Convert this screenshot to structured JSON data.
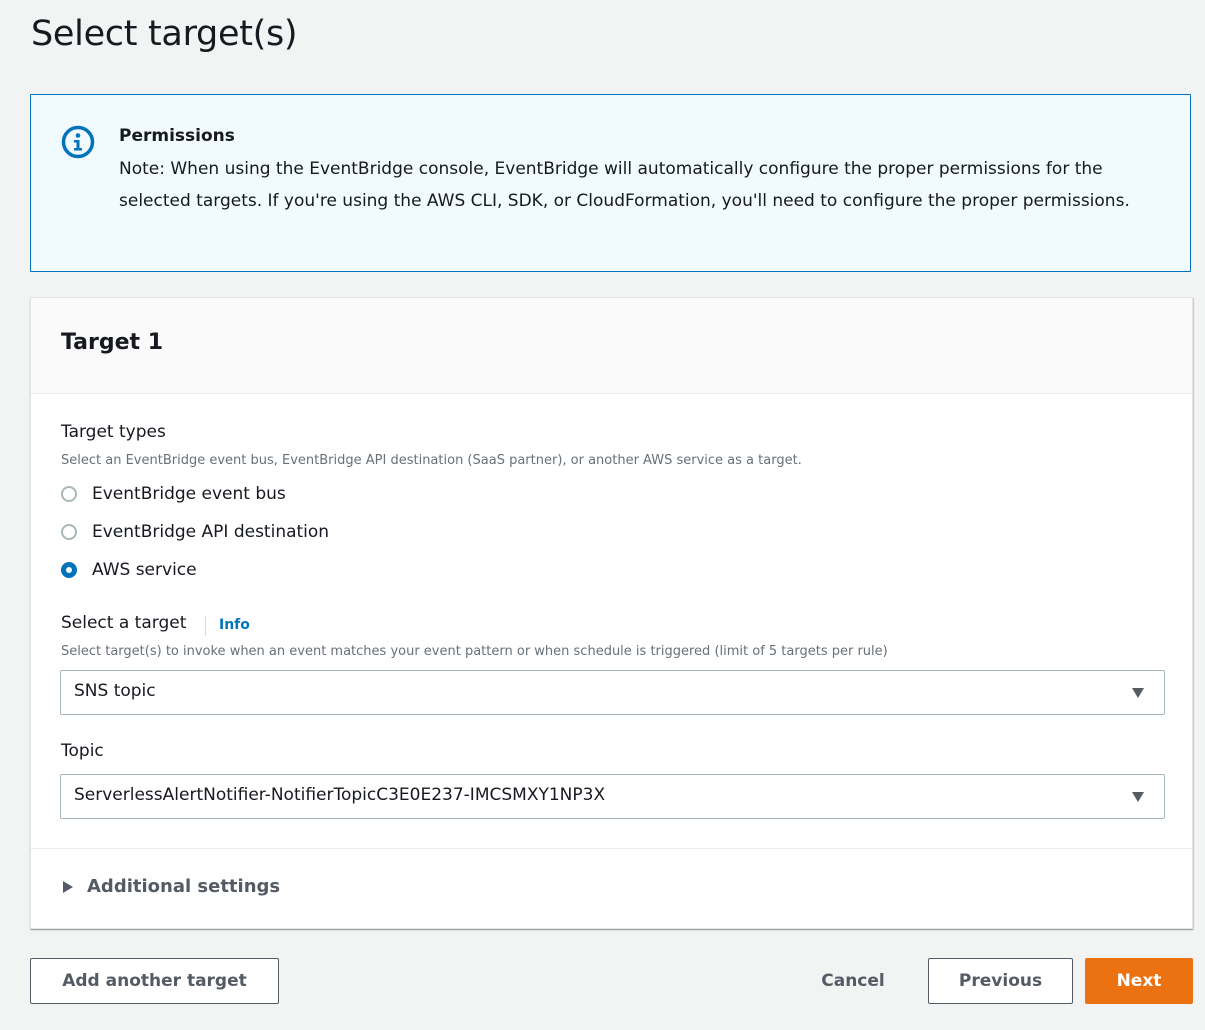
{
  "page": {
    "title": "Select target(s)"
  },
  "alert": {
    "title": "Permissions",
    "body": "Note: When using the EventBridge console, EventBridge will automatically configure the proper permissions for the selected targets. If you're using the AWS CLI, SDK, or CloudFormation, you'll need to configure the proper permissions.",
    "icon": "info-icon",
    "color": "#0073bb"
  },
  "target_card": {
    "title": "Target 1",
    "target_types": {
      "label": "Target types",
      "description": "Select an EventBridge event bus, EventBridge API destination (SaaS partner), or another AWS service as a target.",
      "options": [
        {
          "label": "EventBridge event bus",
          "selected": false
        },
        {
          "label": "EventBridge API destination",
          "selected": false
        },
        {
          "label": "AWS service",
          "selected": true
        }
      ]
    },
    "select_target": {
      "label": "Select a target",
      "info_link": "Info",
      "description": "Select target(s) to invoke when an event matches your event pattern or when schedule is triggered (limit of 5 targets per rule)",
      "value": "SNS topic"
    },
    "topic": {
      "label": "Topic",
      "value": "ServerlessAlertNotifier-NotifierTopicC3E0E237-IMCSMXY1NP3X"
    },
    "additional_settings": {
      "label": "Additional settings",
      "expanded": false
    }
  },
  "footer": {
    "add_target_label": "Add another target",
    "cancel_label": "Cancel",
    "previous_label": "Previous",
    "next_label": "Next",
    "primary_color": "#ec7211"
  }
}
